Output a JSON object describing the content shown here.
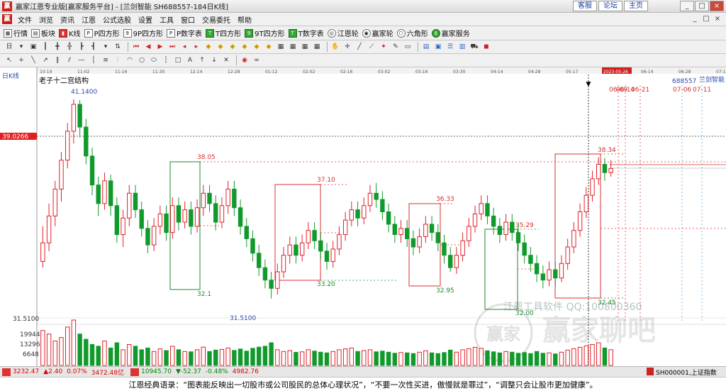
{
  "window": {
    "title": "赢家江恩专业版[赢家服务平台] - [兰剑智能  SH688557-184日K线]",
    "links": [
      "客服",
      "论坛",
      "主页"
    ],
    "controls": [
      "_",
      "□",
      "×"
    ]
  },
  "menu": {
    "items": [
      "文件",
      "浏览",
      "资讯",
      "江恩",
      "公式选股",
      "设置",
      "工具",
      "窗口",
      "交易委托",
      "帮助"
    ],
    "right": [
      "_",
      "□",
      "×"
    ]
  },
  "toolbar": {
    "items": [
      "行情",
      "板块",
      "K线",
      "P四方形",
      "9P四方形",
      "P数字表",
      "T四方形",
      "9T四方形",
      "T数字表",
      "江恩轮",
      "赢家轮",
      "六角形",
      "赢家服务"
    ]
  },
  "chart": {
    "period_label": "日K线",
    "overlay_title": "老子十二宫结构",
    "stock_code": "688557",
    "stock_name": "兰剑智能",
    "watermark_text": "江恩工具软件 QQ:100800360",
    "watermark_brand": "赢家聊吧",
    "watermark_logo_text": "赢家",
    "current_price_label": "39.0266",
    "date_ticks": [
      "10-19",
      "11-02",
      "11-16",
      "11-30",
      "12-14",
      "12-28",
      "01-12",
      "02-02",
      "02-16",
      "03-02",
      "03-16",
      "03-30",
      "04-14",
      "04-28",
      "05-17",
      "2023-05-26",
      "06-14",
      "06-28",
      "07-12"
    ],
    "top_date_labels": [
      "06-09",
      "06-14",
      "06-21",
      "07-06",
      "07-11"
    ],
    "price_labels": [
      "41.1400",
      "38.05",
      "37.10",
      "36.33",
      "35.29",
      "38.34",
      "33.20",
      "32.95",
      "32.00",
      "32.45",
      "32.1",
      "31.5100"
    ],
    "price_axis_low": "31.5100",
    "volume_axis": [
      "19944",
      "13296",
      "6648"
    ],
    "colors": {
      "up": "#e0202a",
      "down": "#109a2c",
      "box_red": "#d83030",
      "box_green": "#1c8a2a",
      "axis": "#333333"
    }
  },
  "chart_data": {
    "type": "candlestick",
    "title": "兰剑智能 SH688557 日K线",
    "y_range": [
      30.5,
      42.0
    ],
    "volume_range": [
      0,
      26000
    ],
    "annotations": {
      "high": 41.14,
      "low": 31.51,
      "current": 39.0266
    },
    "boxes": [
      {
        "label_top": "38.05",
        "label_bottom": "32.1",
        "color": "green"
      },
      {
        "label_top": "37.10",
        "label_bottom": "33.20",
        "color": "red"
      },
      {
        "label_top": "36.33",
        "label_bottom": "32.95",
        "color": "red"
      },
      {
        "label_top": "35.29",
        "label_bottom": "32.00",
        "color": "green"
      },
      {
        "label_top": "38.34",
        "label_bottom": "32.45",
        "color": "red"
      }
    ],
    "candles": [
      [
        33.3,
        34.2,
        33.0,
        35.0
      ],
      [
        34.2,
        35.5,
        33.8,
        36.1
      ],
      [
        35.5,
        36.8,
        35.0,
        37.2
      ],
      [
        36.8,
        38.2,
        36.2,
        38.6
      ],
      [
        38.2,
        39.6,
        37.8,
        40.0
      ],
      [
        39.6,
        40.9,
        39.0,
        41.14
      ],
      [
        40.9,
        39.8,
        39.3,
        41.1
      ],
      [
        39.8,
        38.4,
        38.0,
        40.2
      ],
      [
        38.4,
        37.0,
        36.5,
        38.8
      ],
      [
        37.0,
        36.1,
        35.5,
        37.4
      ],
      [
        36.1,
        37.2,
        35.8,
        37.6
      ],
      [
        37.2,
        36.0,
        35.5,
        37.5
      ],
      [
        36.0,
        34.6,
        34.2,
        36.4
      ],
      [
        34.6,
        35.4,
        34.0,
        35.8
      ],
      [
        35.4,
        36.6,
        35.0,
        37.0
      ],
      [
        36.6,
        35.8,
        35.4,
        37.0
      ],
      [
        35.8,
        34.9,
        34.5,
        36.2
      ],
      [
        34.9,
        34.1,
        33.7,
        35.3
      ],
      [
        34.1,
        35.0,
        33.8,
        35.4
      ],
      [
        35.0,
        35.6,
        34.6,
        36.0
      ],
      [
        35.6,
        34.7,
        34.3,
        36.0
      ],
      [
        34.7,
        36.0,
        34.4,
        36.4
      ],
      [
        36.0,
        35.2,
        34.8,
        36.4
      ],
      [
        35.2,
        35.8,
        34.9,
        36.2
      ],
      [
        35.8,
        35.0,
        34.6,
        36.2
      ],
      [
        35.0,
        35.9,
        34.7,
        36.3
      ],
      [
        35.9,
        36.6,
        35.5,
        37.0
      ],
      [
        36.6,
        36.1,
        35.7,
        37.0
      ],
      [
        36.1,
        35.2,
        34.8,
        36.5
      ],
      [
        35.2,
        36.0,
        34.9,
        36.4
      ],
      [
        36.0,
        36.8,
        35.6,
        37.2
      ],
      [
        36.8,
        35.9,
        35.5,
        37.2
      ],
      [
        35.9,
        35.0,
        34.6,
        36.3
      ],
      [
        35.0,
        34.4,
        34.0,
        35.4
      ],
      [
        34.4,
        33.7,
        33.3,
        34.8
      ],
      [
        33.7,
        33.0,
        32.6,
        34.1
      ],
      [
        33.0,
        32.4,
        32.0,
        33.4
      ],
      [
        32.4,
        32.0,
        31.51,
        32.8
      ],
      [
        32.0,
        32.8,
        31.7,
        33.2
      ],
      [
        32.8,
        33.6,
        32.5,
        34.0
      ],
      [
        33.6,
        34.1,
        33.2,
        34.5
      ],
      [
        34.1,
        33.6,
        33.2,
        34.5
      ],
      [
        33.6,
        34.2,
        33.3,
        34.6
      ],
      [
        34.2,
        34.8,
        33.9,
        35.2
      ],
      [
        34.8,
        34.3,
        33.9,
        35.2
      ],
      [
        34.3,
        33.8,
        33.4,
        34.7
      ],
      [
        33.8,
        33.3,
        32.9,
        34.2
      ],
      [
        33.3,
        33.9,
        33.0,
        34.3
      ],
      [
        33.9,
        34.6,
        33.6,
        35.0
      ],
      [
        34.6,
        35.3,
        34.3,
        35.7
      ],
      [
        35.3,
        35.8,
        35.0,
        36.2
      ],
      [
        35.8,
        35.4,
        35.0,
        36.2
      ],
      [
        35.4,
        36.0,
        35.1,
        36.4
      ],
      [
        36.0,
        36.6,
        35.7,
        37.0
      ],
      [
        36.6,
        36.3,
        35.9,
        37.1
      ],
      [
        36.3,
        35.7,
        35.3,
        36.7
      ],
      [
        35.7,
        35.1,
        34.7,
        36.1
      ],
      [
        35.1,
        34.6,
        34.2,
        35.5
      ],
      [
        34.6,
        34.9,
        34.2,
        35.3
      ],
      [
        34.9,
        34.4,
        34.0,
        35.3
      ],
      [
        34.4,
        34.0,
        33.6,
        34.8
      ],
      [
        34.0,
        34.5,
        33.7,
        34.9
      ],
      [
        34.5,
        35.1,
        34.2,
        35.5
      ],
      [
        35.1,
        34.7,
        34.3,
        35.5
      ],
      [
        34.7,
        34.2,
        33.8,
        35.1
      ],
      [
        34.2,
        33.6,
        33.2,
        34.6
      ],
      [
        33.6,
        33.0,
        32.8,
        34.0
      ],
      [
        33.0,
        33.6,
        32.7,
        34.0
      ],
      [
        33.6,
        34.3,
        33.3,
        34.7
      ],
      [
        34.3,
        35.0,
        34.0,
        35.4
      ],
      [
        35.0,
        35.6,
        34.7,
        36.0
      ],
      [
        35.6,
        36.1,
        35.3,
        36.5
      ],
      [
        36.1,
        35.5,
        35.1,
        36.5
      ],
      [
        35.5,
        35.0,
        34.6,
        35.9
      ],
      [
        35.0,
        34.6,
        34.2,
        35.4
      ],
      [
        34.6,
        35.2,
        34.3,
        35.6
      ],
      [
        35.2,
        34.7,
        34.3,
        35.6
      ],
      [
        34.7,
        34.2,
        33.8,
        35.1
      ],
      [
        34.2,
        33.6,
        33.2,
        34.6
      ],
      [
        33.6,
        33.2,
        32.8,
        34.0
      ],
      [
        33.2,
        32.7,
        32.3,
        33.6
      ],
      [
        32.7,
        32.4,
        32.0,
        33.1
      ],
      [
        32.4,
        32.9,
        32.1,
        33.3
      ],
      [
        32.9,
        32.5,
        32.1,
        33.3
      ],
      [
        32.5,
        33.2,
        32.3,
        33.6
      ],
      [
        33.2,
        34.0,
        32.9,
        34.4
      ],
      [
        34.0,
        34.8,
        33.7,
        35.2
      ],
      [
        34.8,
        35.7,
        34.5,
        36.1
      ],
      [
        35.7,
        36.5,
        35.4,
        36.9
      ],
      [
        36.5,
        37.3,
        36.2,
        37.7
      ],
      [
        37.3,
        38.0,
        37.0,
        38.34
      ],
      [
        38.0,
        37.6,
        37.2,
        38.3
      ],
      [
        37.6,
        37.8,
        37.4,
        38.2
      ]
    ],
    "volumes": [
      20000,
      18000,
      14000,
      16000,
      22000,
      26000,
      18000,
      15000,
      12000,
      11000,
      14000,
      10000,
      13000,
      9000,
      12000,
      11000,
      9000,
      10000,
      8000,
      9500,
      8500,
      11000,
      9000,
      8000,
      7800,
      9000,
      10500,
      8000,
      8800,
      9200,
      10000,
      8600,
      9400,
      8200,
      9800,
      10500,
      11000,
      13000,
      9000,
      8000,
      8500,
      7500,
      7800,
      9000,
      8200,
      7600,
      7200,
      8000,
      9000,
      9500,
      10000,
      8000,
      8500,
      9000,
      7800,
      8200,
      7600,
      7000,
      7400,
      7200,
      6800,
      7600,
      8400,
      7200,
      6800,
      7400,
      8800,
      7600,
      9000,
      9600,
      10400,
      9800,
      8400,
      7800,
      7200,
      8000,
      7600,
      7000,
      7400,
      6800,
      8000,
      7000,
      7200,
      6600,
      7600,
      8800,
      9600,
      10400,
      11200,
      12000,
      13000,
      10000,
      9000
    ]
  },
  "statusbar": {
    "index1": "3232.47",
    "index1_change": "▲2.40",
    "index1_pct": "0.07%",
    "index1_amount": "3472.48亿",
    "index2": "10945.70",
    "index2_change": "▼-52.37",
    "index2_pct": "-0.48%",
    "index2_amount": "4982.76",
    "right_label": "SH000001,上证指数"
  },
  "quote": "江恩经典语录：“图表能反映出一切股市或公司股民的总体心理状况”，“不要一次性买进，傲慢就是罪过”，“调整只会让股市更加健康”。"
}
